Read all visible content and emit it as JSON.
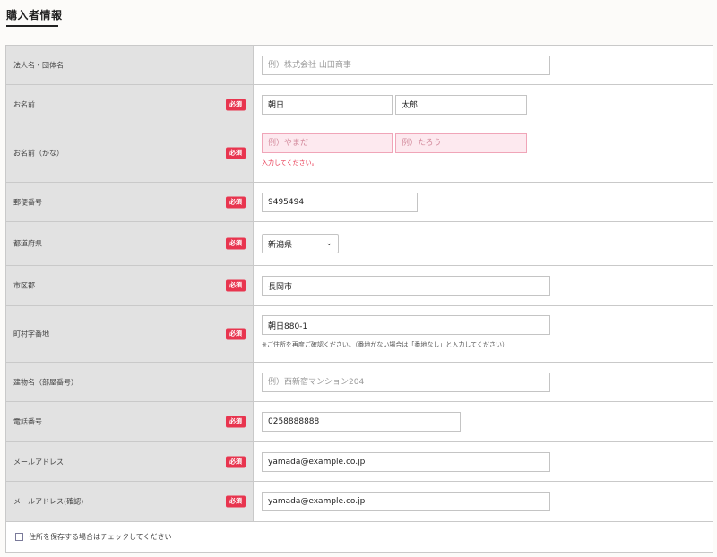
{
  "page": {
    "section_title": "購入者情報"
  },
  "colors": {
    "required_badge": "#e8354f",
    "label_bg": "#e2e2e2",
    "error_bg": "#fde9ef"
  },
  "fields": {
    "company": {
      "label": "法人名・団体名",
      "placeholder": "例）株式会社 山田商事",
      "value": ""
    },
    "name": {
      "label": "お名前",
      "required": "必須",
      "last": "朝日",
      "first": "太郎"
    },
    "kana": {
      "label": "お名前（かな）",
      "required": "必須",
      "last_placeholder": "例）やまだ",
      "first_placeholder": "例）たろう",
      "error": "入力してください。"
    },
    "postal": {
      "label": "郵便番号",
      "required": "必須",
      "value": "9495494"
    },
    "prefecture": {
      "label": "都道府県",
      "required": "必須",
      "selected": "新潟県"
    },
    "city": {
      "label": "市区郡",
      "required": "必須",
      "value": "長岡市"
    },
    "address": {
      "label": "町村字番地",
      "required": "必須",
      "value": "朝日880-1",
      "note": "※ご住所を再度ご確認ください。（番地がない場合は「番地なし」と入力してください）"
    },
    "building": {
      "label": "建物名（部屋番号）",
      "placeholder": "例）西新宿マンション204",
      "value": ""
    },
    "phone": {
      "label": "電話番号",
      "required": "必須",
      "value": "0258888888"
    },
    "email": {
      "label": "メールアドレス",
      "required": "必須",
      "value": "yamada@example.co.jp"
    },
    "email_confirm": {
      "label": "メールアドレス(確認)",
      "required": "必須",
      "value": "yamada@example.co.jp"
    }
  },
  "save_address": {
    "label": "住所を保存する場合はチェックしてください",
    "checked": false
  }
}
